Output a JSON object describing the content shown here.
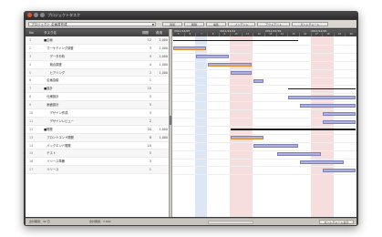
{
  "app": {
    "title": "プロジェクトタスク"
  },
  "toolbar": {
    "project_name": "プロジェクト 企画書作成",
    "buttons": [
      "追加",
      "削除",
      "編集",
      "インデント",
      "アウトデント",
      "ガントチャート"
    ]
  },
  "table": {
    "columns": [
      "No",
      "タスク名",
      "期間",
      "費用"
    ],
    "rows": [
      {
        "num": "1",
        "name": "■企画",
        "dur": "12",
        "cost": "1,000"
      },
      {
        "num": "2",
        "name": "　マーケティング調査",
        "dur": "3",
        "cost": "1,000"
      },
      {
        "num": "3",
        "name": "　　データ分析",
        "dur": "3",
        "cost": "1,000"
      },
      {
        "num": "4",
        "name": "　　競合調査",
        "dur": "4",
        "cost": "1,000"
      },
      {
        "num": "5",
        "name": "　　ヒアリング",
        "dur": "2",
        "cost": "1,000"
      },
      {
        "num": "6",
        "name": "　企画会議",
        "dur": "1",
        "cost": ""
      },
      {
        "num": "7",
        "name": "■設計",
        "dur": "15",
        "cost": ""
      },
      {
        "num": "8",
        "name": "　仕様設計",
        "dur": "5",
        "cost": ""
      },
      {
        "num": "9",
        "name": "　画面設計",
        "dur": "5",
        "cost": ""
      },
      {
        "num": "10",
        "name": "　　デザイン作成",
        "dur": "3",
        "cost": ""
      },
      {
        "num": "11",
        "name": "　　デザインレビュー",
        "dur": "2",
        "cost": ""
      },
      {
        "num": "12",
        "name": "■開発",
        "dur": "20",
        "cost": "1,000"
      },
      {
        "num": "13",
        "name": "　フロントエンド開発",
        "dur": "8",
        "cost": "1,000"
      },
      {
        "num": "14",
        "name": "　バックエンド開発",
        "dur": "10",
        "cost": ""
      },
      {
        "num": "15",
        "name": "　テスト",
        "dur": "5",
        "cost": ""
      },
      {
        "num": "16",
        "name": "　リリース準備",
        "dur": "3",
        "cost": ""
      },
      {
        "num": "17",
        "name": "　リリース",
        "dur": "1",
        "cost": ""
      }
    ]
  },
  "gantt": {
    "weeks": [
      "2011/12/05",
      "2011/12/12",
      "2011/12/19",
      "2011/12/26"
    ],
    "days": [
      "5",
      "6",
      "7",
      "8",
      "9",
      "10",
      "11",
      "12",
      "13",
      "14",
      "15",
      "16",
      "17",
      "18",
      "19",
      "20"
    ],
    "weekend_days": [
      5,
      6,
      12,
      13
    ],
    "today_day": 2,
    "bars": [
      {
        "row": 0,
        "start": 0,
        "len": 11,
        "kind": "summary"
      },
      {
        "row": 1,
        "start": 0,
        "len": 3,
        "kind": "task",
        "orange": true
      },
      {
        "row": 2,
        "start": 2,
        "len": 3,
        "kind": "task",
        "orange": true
      },
      {
        "row": 3,
        "start": 3,
        "len": 4,
        "kind": "task",
        "orange": true
      },
      {
        "row": 4,
        "start": 5,
        "len": 2,
        "kind": "task"
      },
      {
        "row": 5,
        "start": 7,
        "len": 1,
        "kind": "task"
      },
      {
        "row": 6,
        "start": 10,
        "len": 6,
        "kind": "summary"
      },
      {
        "row": 7,
        "start": 10,
        "len": 6,
        "kind": "task"
      },
      {
        "row": 8,
        "start": 11,
        "len": 5,
        "kind": "task"
      },
      {
        "row": 9,
        "start": 13,
        "len": 3,
        "kind": "task"
      },
      {
        "row": 10,
        "start": 13,
        "len": 3,
        "kind": "task"
      },
      {
        "row": 11,
        "start": 5,
        "len": 11,
        "kind": "summary"
      },
      {
        "row": 12,
        "start": 5,
        "len": 3,
        "kind": "task",
        "orange": true
      },
      {
        "row": 13,
        "start": 7,
        "len": 4,
        "kind": "task"
      },
      {
        "row": 14,
        "start": 9,
        "len": 4,
        "kind": "task"
      },
      {
        "row": 15,
        "start": 11,
        "len": 4,
        "kind": "task"
      },
      {
        "row": 16,
        "start": 13,
        "len": 3,
        "kind": "task"
      }
    ]
  },
  "status": {
    "left": "合計期間：32 日",
    "middle": "合計費用：7,000",
    "button": "ガントチャート表示"
  },
  "colors": {
    "bar": "#aeb0dc",
    "summary": "#1c1c1c",
    "weekend": "#f6dede",
    "accent": "#e58a2c"
  }
}
